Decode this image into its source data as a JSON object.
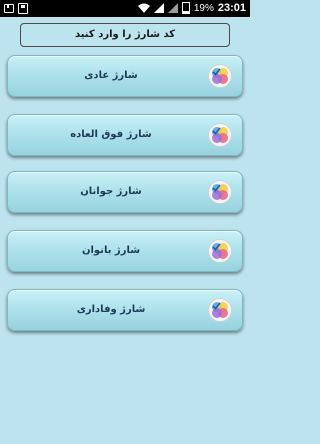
{
  "status_bar": {
    "battery": "19%",
    "time": "23:01"
  },
  "code_input": {
    "placeholder": "کد شارژ را وارد کنید"
  },
  "menu": {
    "items": [
      {
        "label": "شارژ عادی",
        "icon": "operator-petals-icon"
      },
      {
        "label": "شارژ فوق العاده",
        "icon": "operator-petals-icon"
      },
      {
        "label": "شارژ جوانان",
        "icon": "operator-petals-icon"
      },
      {
        "label": "شارژ بانوان",
        "icon": "operator-petals-icon"
      },
      {
        "label": "شارژ وفاداری",
        "icon": "operator-petals-icon"
      }
    ]
  },
  "colors": {
    "background": "#bde3ee",
    "button": "#aadfe9",
    "label": "#1f3a56"
  }
}
